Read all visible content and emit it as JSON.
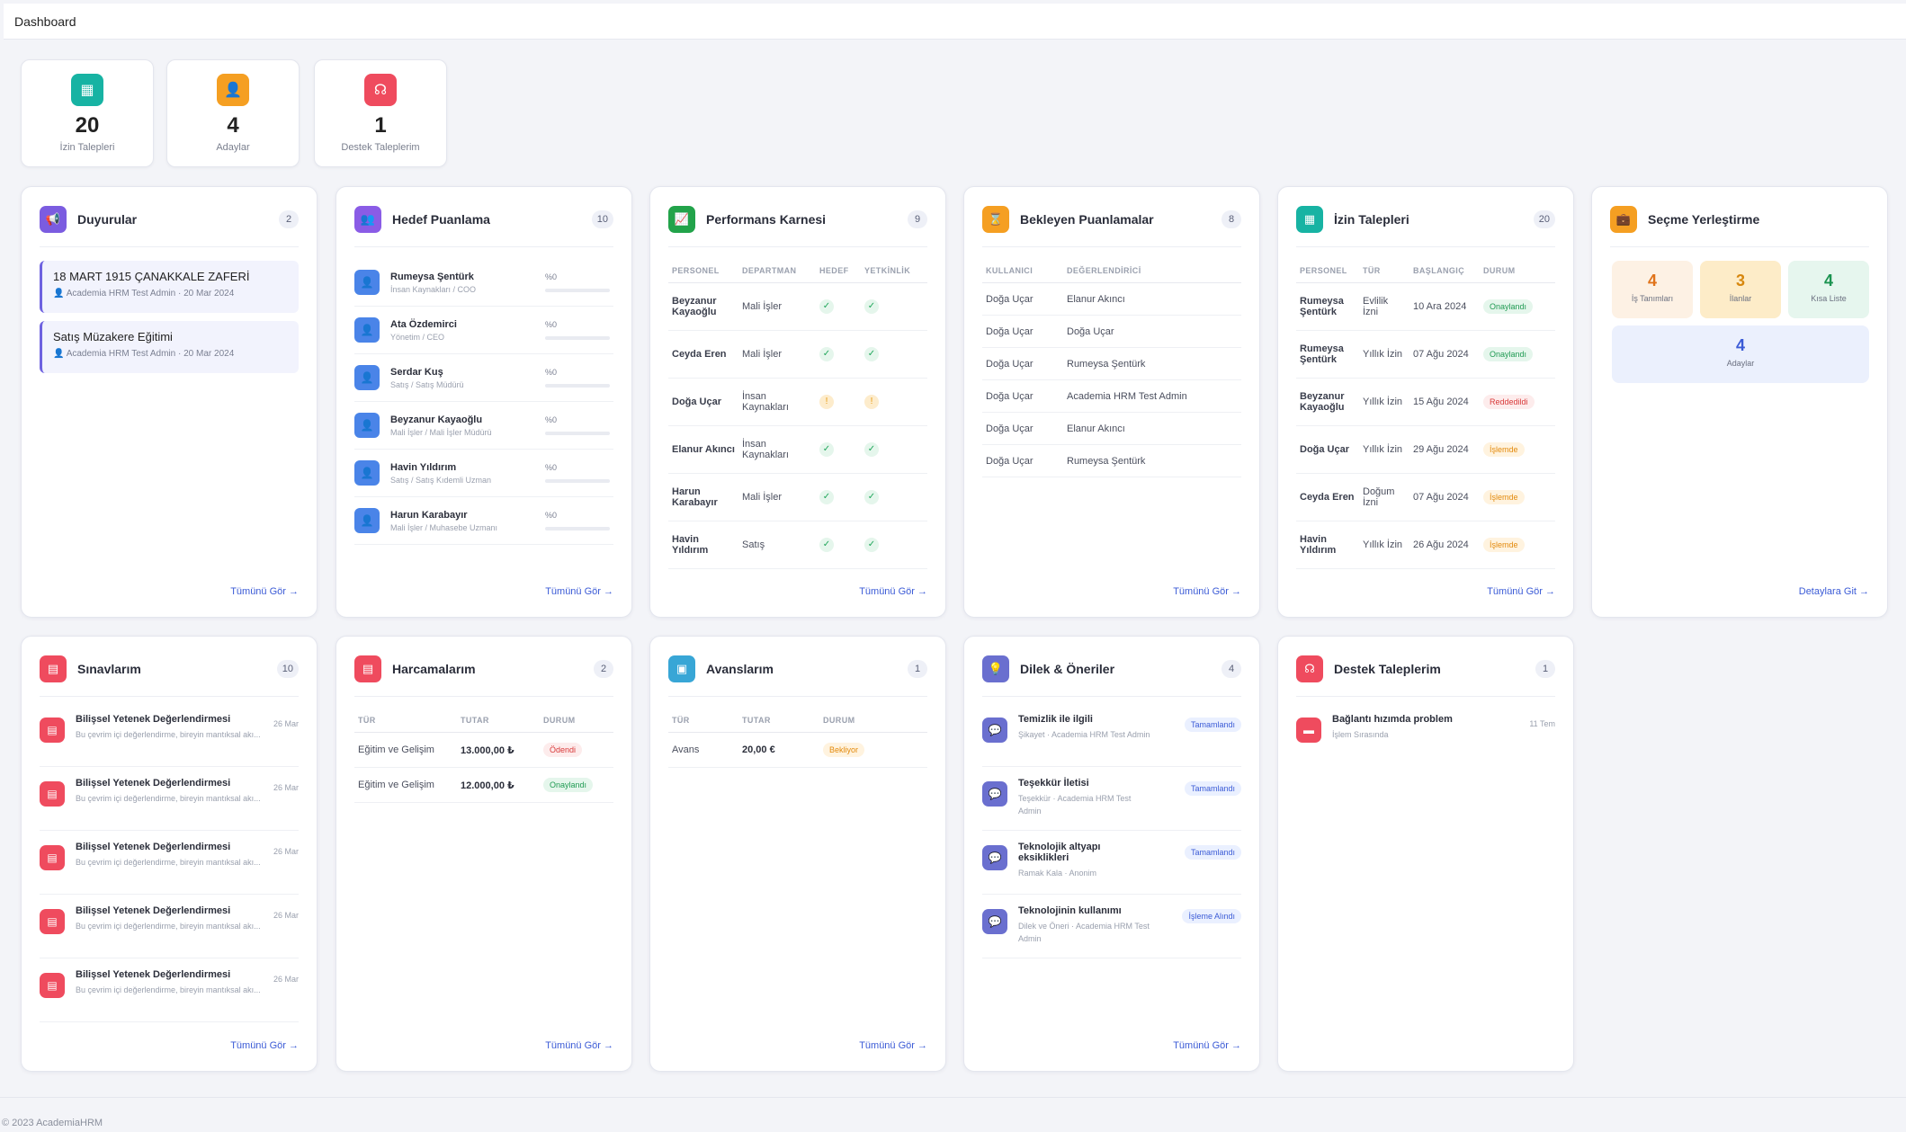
{
  "header": {
    "title": "Dashboard"
  },
  "stats": [
    {
      "value": "20",
      "label": "İzin Talepleri",
      "color": "#17b3a3",
      "icon": "calendar-icon"
    },
    {
      "value": "4",
      "label": "Adaylar",
      "color": "#f59f22",
      "icon": "user-plus-icon"
    },
    {
      "value": "1",
      "label": "Destek Taleplerim",
      "color": "#ef4b5e",
      "icon": "headset-icon"
    }
  ],
  "common": {
    "see_all": "Tümünü Gör →",
    "details": "Detaylara Git →"
  },
  "duyurular": {
    "title": "Duyurular",
    "count": "2",
    "color": "#7b5ce0",
    "items": [
      {
        "title": "18 MART 1915 ÇANAKKALE ZAFERİ",
        "meta": "Academia HRM Test Admin · 20 Mar 2024"
      },
      {
        "title": "Satış Müzakere Eğitimi",
        "meta": "Academia HRM Test Admin · 20 Mar 2024"
      }
    ]
  },
  "hedef": {
    "title": "Hedef Puanlama",
    "count": "10",
    "color": "#8a5ce6",
    "items": [
      {
        "name": "Rumeysa Şentürk",
        "sub": "İnsan Kaynakları / COO",
        "pct": "%0"
      },
      {
        "name": "Ata Özdemirci",
        "sub": "Yönetim / CEO",
        "pct": "%0"
      },
      {
        "name": "Serdar Kuş",
        "sub": "Satış / Satış Müdürü",
        "pct": "%0"
      },
      {
        "name": "Beyzanur Kayaoğlu",
        "sub": "Mali İşler / Mali İşler Müdürü",
        "pct": "%0"
      },
      {
        "name": "Havin Yıldırım",
        "sub": "Satış / Satış Kıdemli Uzman",
        "pct": "%0"
      },
      {
        "name": "Harun Karabayır",
        "sub": "Mali İşler / Muhasebe Uzmanı",
        "pct": "%0"
      }
    ]
  },
  "performans": {
    "title": "Performans Karnesi",
    "count": "9",
    "color": "#22a34a",
    "headers": [
      "PERSONEL",
      "DEPARTMAN",
      "HEDEF",
      "YETKİNLİK"
    ],
    "rows": [
      {
        "name": "Beyzanur Kayaoğlu",
        "dept": "Mali İşler",
        "hedef": "✓",
        "yet": "✓"
      },
      {
        "name": "Ceyda Eren",
        "dept": "Mali İşler",
        "hedef": "✓",
        "yet": "✓"
      },
      {
        "name": "Doğa Uçar",
        "dept": "İnsan Kaynakları",
        "hedef": "!",
        "yet": "!"
      },
      {
        "name": "Elanur Akıncı",
        "dept": "İnsan Kaynakları",
        "hedef": "✓",
        "yet": "✓"
      },
      {
        "name": "Harun Karabayır",
        "dept": "Mali İşler",
        "hedef": "✓",
        "yet": "✓"
      },
      {
        "name": "Havin Yıldırım",
        "dept": "Satış",
        "hedef": "✓",
        "yet": "✓"
      }
    ]
  },
  "bekleyen": {
    "title": "Bekleyen Puanlamalar",
    "count": "8",
    "color": "#f59f22",
    "headers": [
      "KULLANICI",
      "DEĞERLENDİRİCİ"
    ],
    "rows": [
      {
        "user": "Doğa Uçar",
        "eval": "Elanur Akıncı"
      },
      {
        "user": "Doğa Uçar",
        "eval": "Doğa Uçar"
      },
      {
        "user": "Doğa Uçar",
        "eval": "Rumeysa Şentürk"
      },
      {
        "user": "Doğa Uçar",
        "eval": "Academia HRM Test Admin"
      },
      {
        "user": "Doğa Uçar",
        "eval": "Elanur Akıncı"
      },
      {
        "user": "Doğa Uçar",
        "eval": "Rumeysa Şentürk"
      }
    ]
  },
  "izin": {
    "title": "İzin Talepleri",
    "count": "20",
    "color": "#17b3a3",
    "headers": [
      "PERSONEL",
      "TÜR",
      "BAŞLANGIÇ",
      "DURUM"
    ],
    "rows": [
      {
        "name": "Rumeysa Şentürk",
        "type": "Evlilik İzni",
        "date": "10 Ara 2024",
        "status": "Onaylandı",
        "cls": "g"
      },
      {
        "name": "Rumeysa Şentürk",
        "type": "Yıllık İzin",
        "date": "07 Ağu 2024",
        "status": "Onaylandı",
        "cls": "g"
      },
      {
        "name": "Beyzanur Kayaoğlu",
        "type": "Yıllık İzin",
        "date": "15 Ağu 2024",
        "status": "Reddedildi",
        "cls": "r"
      },
      {
        "name": "Doğa Uçar",
        "type": "Yıllık İzin",
        "date": "29 Ağu 2024",
        "status": "İşlemde",
        "cls": "o"
      },
      {
        "name": "Ceyda Eren",
        "type": "Doğum İzni",
        "date": "07 Ağu 2024",
        "status": "İşlemde",
        "cls": "o"
      },
      {
        "name": "Havin Yıldırım",
        "type": "Yıllık İzin",
        "date": "26 Ağu 2024",
        "status": "İşlemde",
        "cls": "o"
      }
    ]
  },
  "secme": {
    "title": "Seçme Yerleştirme",
    "color": "#f59f22",
    "tiles": [
      {
        "value": "4",
        "label": "İş Tanımları",
        "bg": "#fdf1e4",
        "fg": "#e0731a"
      },
      {
        "value": "3",
        "label": "İlanlar",
        "bg": "#fdecc8",
        "fg": "#d7870e"
      },
      {
        "value": "4",
        "label": "Kısa Liste",
        "bg": "#e6f6ee",
        "fg": "#1b9350"
      },
      {
        "value": "4",
        "label": "Adaylar",
        "bg": "#ebf0fd",
        "fg": "#3b5bd6"
      }
    ]
  },
  "sinav": {
    "title": "Sınavlarım",
    "count": "10",
    "color": "#ef4b5e",
    "items": [
      {
        "name": "Bilişsel Yetenek Değerlendirmesi",
        "desc": "Bu çevrim içi değerlendirme, bireyin mantıksal akı...",
        "date": "26 Mar"
      },
      {
        "name": "Bilişsel Yetenek Değerlendirmesi",
        "desc": "Bu çevrim içi değerlendirme, bireyin mantıksal akı...",
        "date": "26 Mar"
      },
      {
        "name": "Bilişsel Yetenek Değerlendirmesi",
        "desc": "Bu çevrim içi değerlendirme, bireyin mantıksal akı...",
        "date": "26 Mar"
      },
      {
        "name": "Bilişsel Yetenek Değerlendirmesi",
        "desc": "Bu çevrim içi değerlendirme, bireyin mantıksal akı...",
        "date": "26 Mar"
      },
      {
        "name": "Bilişsel Yetenek Değerlendirmesi",
        "desc": "Bu çevrim içi değerlendirme, bireyin mantıksal akı...",
        "date": "26 Mar"
      }
    ]
  },
  "harcama": {
    "title": "Harcamalarım",
    "count": "2",
    "color": "#ef4b5e",
    "headers": [
      "TÜR",
      "TUTAR",
      "DURUM"
    ],
    "rows": [
      {
        "type": "Eğitim ve Gelişim",
        "amount": "13.000,00 ₺",
        "status": "Ödendi",
        "cls": "r"
      },
      {
        "type": "Eğitim ve Gelişim",
        "amount": "12.000,00 ₺",
        "status": "Onaylandı",
        "cls": "g"
      }
    ]
  },
  "avans": {
    "title": "Avanslarım",
    "count": "1",
    "color": "#38a6d6",
    "headers": [
      "TÜR",
      "TUTAR",
      "DURUM"
    ],
    "rows": [
      {
        "type": "Avans",
        "amount": "20,00 €",
        "status": "Bekliyor",
        "cls": "o"
      }
    ]
  },
  "dilek": {
    "title": "Dilek & Öneriler",
    "count": "4",
    "color": "#6a6fcf",
    "items": [
      {
        "name": "Temizlik ile ilgili",
        "sub": "Şikayet · Academia HRM Test Admin",
        "status": "Tamamlandı"
      },
      {
        "name": "Teşekkür İletisi",
        "sub": "Teşekkür · Academia HRM Test Admin",
        "status": "Tamamlandı"
      },
      {
        "name": "Teknolojik altyapı eksiklikleri",
        "sub": "Ramak Kala · Anonim",
        "status": "Tamamlandı"
      },
      {
        "name": "Teknolojinin kullanımı",
        "sub": "Dilek ve Öneri · Academia HRM Test Admin",
        "status": "İşleme Alındı"
      }
    ]
  },
  "destek": {
    "title": "Destek Taleplerim",
    "count": "1",
    "color": "#ef4b5e",
    "items": [
      {
        "name": "Bağlantı hızımda problem",
        "sub": "İşlem Sırasında",
        "date": "11 Tem"
      }
    ]
  },
  "footer": "© 2023 AcademiaHRM"
}
